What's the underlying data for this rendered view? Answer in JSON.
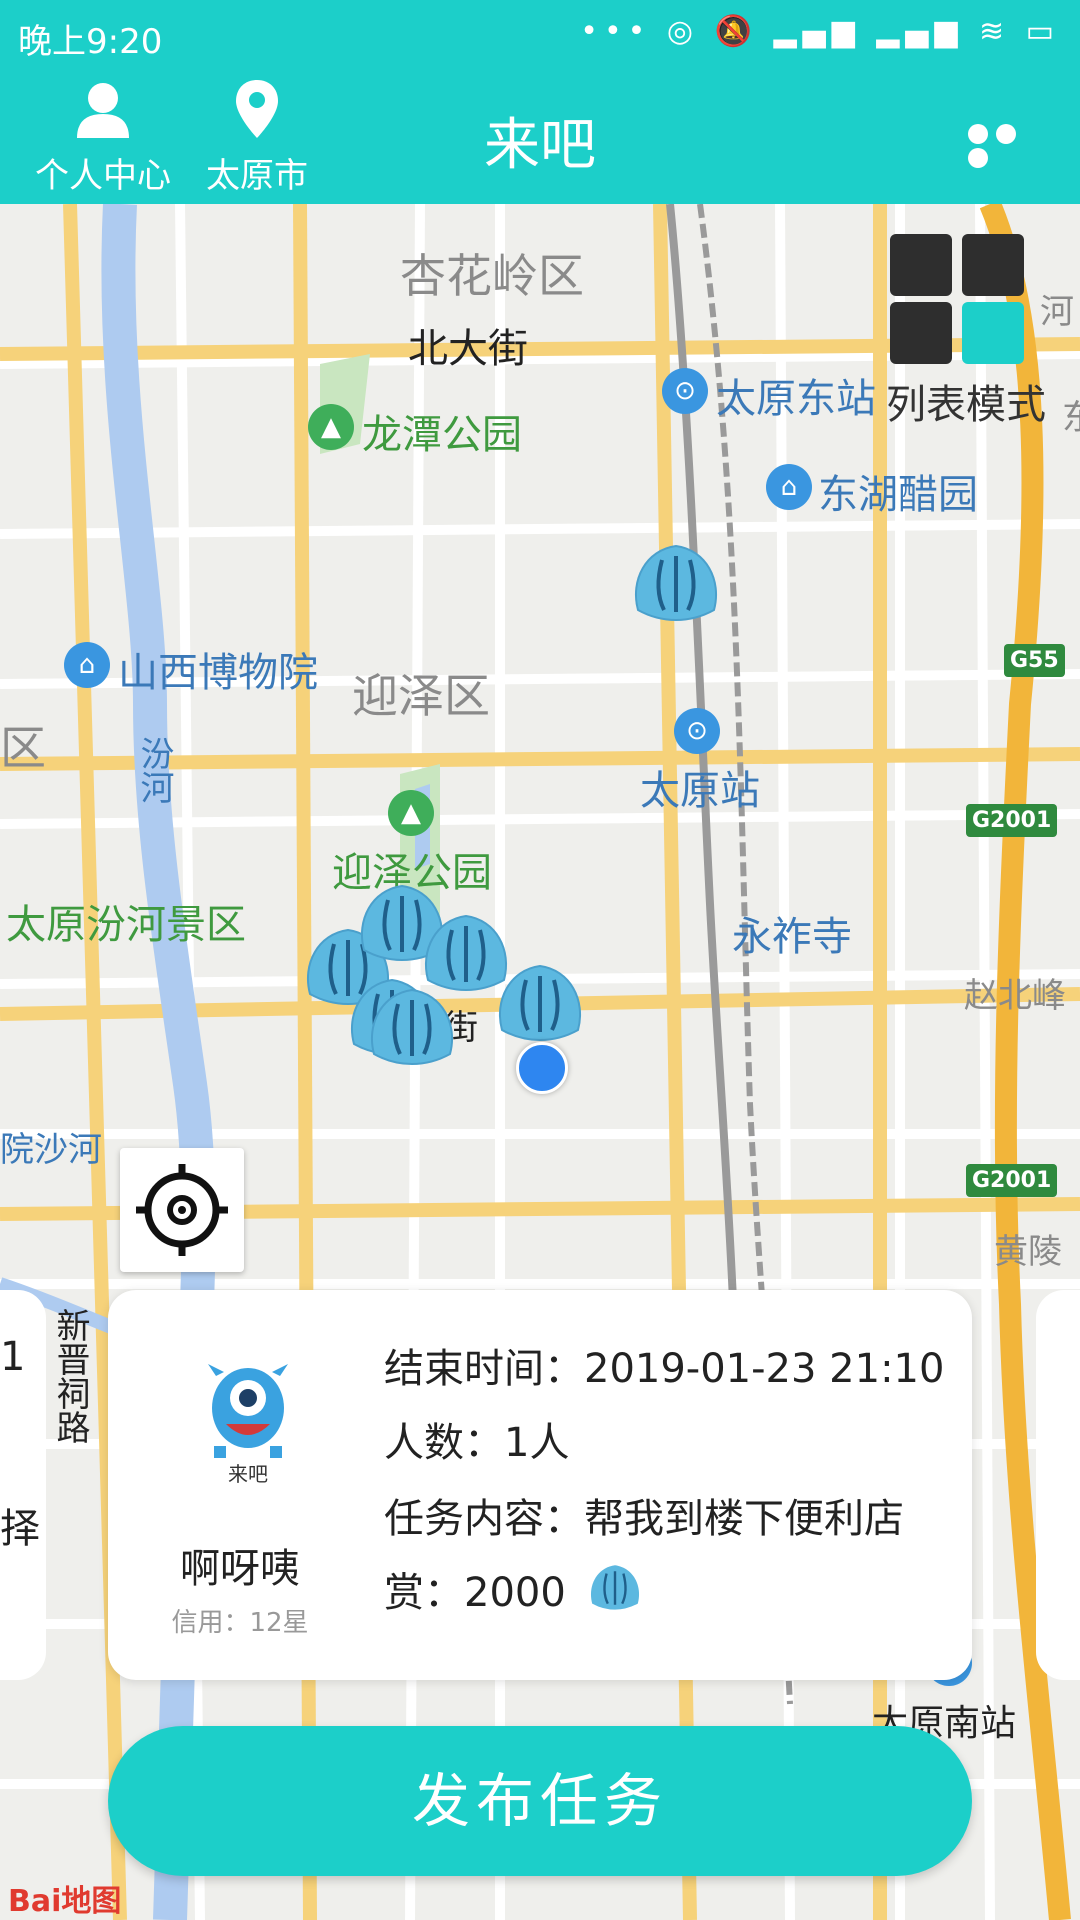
{
  "status_bar": {
    "time": "晚上9:20",
    "icons": "••• ◎ 🔕 ▂▄▆ ▂▄▆ ≋ ▭"
  },
  "header": {
    "profile_label": "个人中心",
    "city_label": "太原市",
    "title": "来吧"
  },
  "map": {
    "places": {
      "xinghualing": "杏花岭区",
      "beidajie": "北大街",
      "longtan": "龙潭公园",
      "dongzhan": "太原东站",
      "donghu": "东湖醋园",
      "museum": "山西博物院",
      "yingze_district": "迎泽区",
      "fen_river": "汾河",
      "qu": "区",
      "taiyuan_station": "太原站",
      "yingze_park": "迎泽公园",
      "fenhe_scenic": "太原汾河景区",
      "yongzuo": "永祚寺",
      "zhaobeifeng": "赵北峰",
      "shahe": "院沙河",
      "huangling": "黄陵",
      "he": "河",
      "dong": "东",
      "south_station": "太原南站",
      "jie": "街",
      "xinjin": "新晋祠路"
    },
    "highways": [
      "G55",
      "G2001",
      "G2001"
    ],
    "list_mode_label": "列表模式",
    "baidu": "Bai地图"
  },
  "task_card": {
    "avatar_caption": "来吧",
    "username": "啊呀咦",
    "credit": "信用：12星",
    "end_time": "结束时间：2019-01-23 21:10",
    "people": "人数：1人",
    "content": "任务内容：帮我到楼下便利店",
    "reward": "赏：2000"
  },
  "side_card_left": {
    "line1": "1",
    "line2": "择"
  },
  "publish_button": "发布任务",
  "colors": {
    "accent": "#1ccfc9",
    "shell": "#5cb8e0"
  }
}
